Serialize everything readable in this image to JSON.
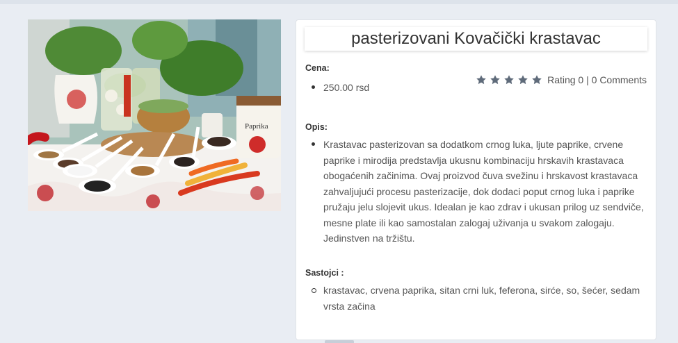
{
  "product": {
    "title": "pasterizovani Kovačički krastavac",
    "image_label": "Paprika",
    "price": {
      "label": "Cena:",
      "value": "250.00 rsd"
    },
    "rating": {
      "stars": 5,
      "icon": "star-icon",
      "text": "Rating 0 | 0 Comments"
    },
    "description": {
      "label": "Opis:",
      "text": "Krastavac pasterizovan sa dodatkom crnog luka, ljute paprike, crvene paprike i mirodija predstavlja ukusnu kombinaciju hrskavih krastavaca obogaćenih začinima. Ovaj proizvod čuva svežinu i hrskavost krastavaca zahvaljujući procesu pasterizacije, dok dodaci poput crnog luka i paprike pružaju jelu slojevit ukus. Idealan je kao zdrav i ukusan prilog uz sendviče, mesne plate ili kao samostalan zalogaj uživanja u svakom zalogaju. Jedinstven na tržištu."
    },
    "ingredients": {
      "label": "Sastojci :",
      "text": "krastavac, crvena paprika, sitan crni luk, feferona, sirće, so, šećer, sedam vrsta začina"
    }
  },
  "colors": {
    "background": "#e9edf3",
    "card": "#ffffff",
    "star": "#5f6b7a",
    "title": "#333333"
  }
}
